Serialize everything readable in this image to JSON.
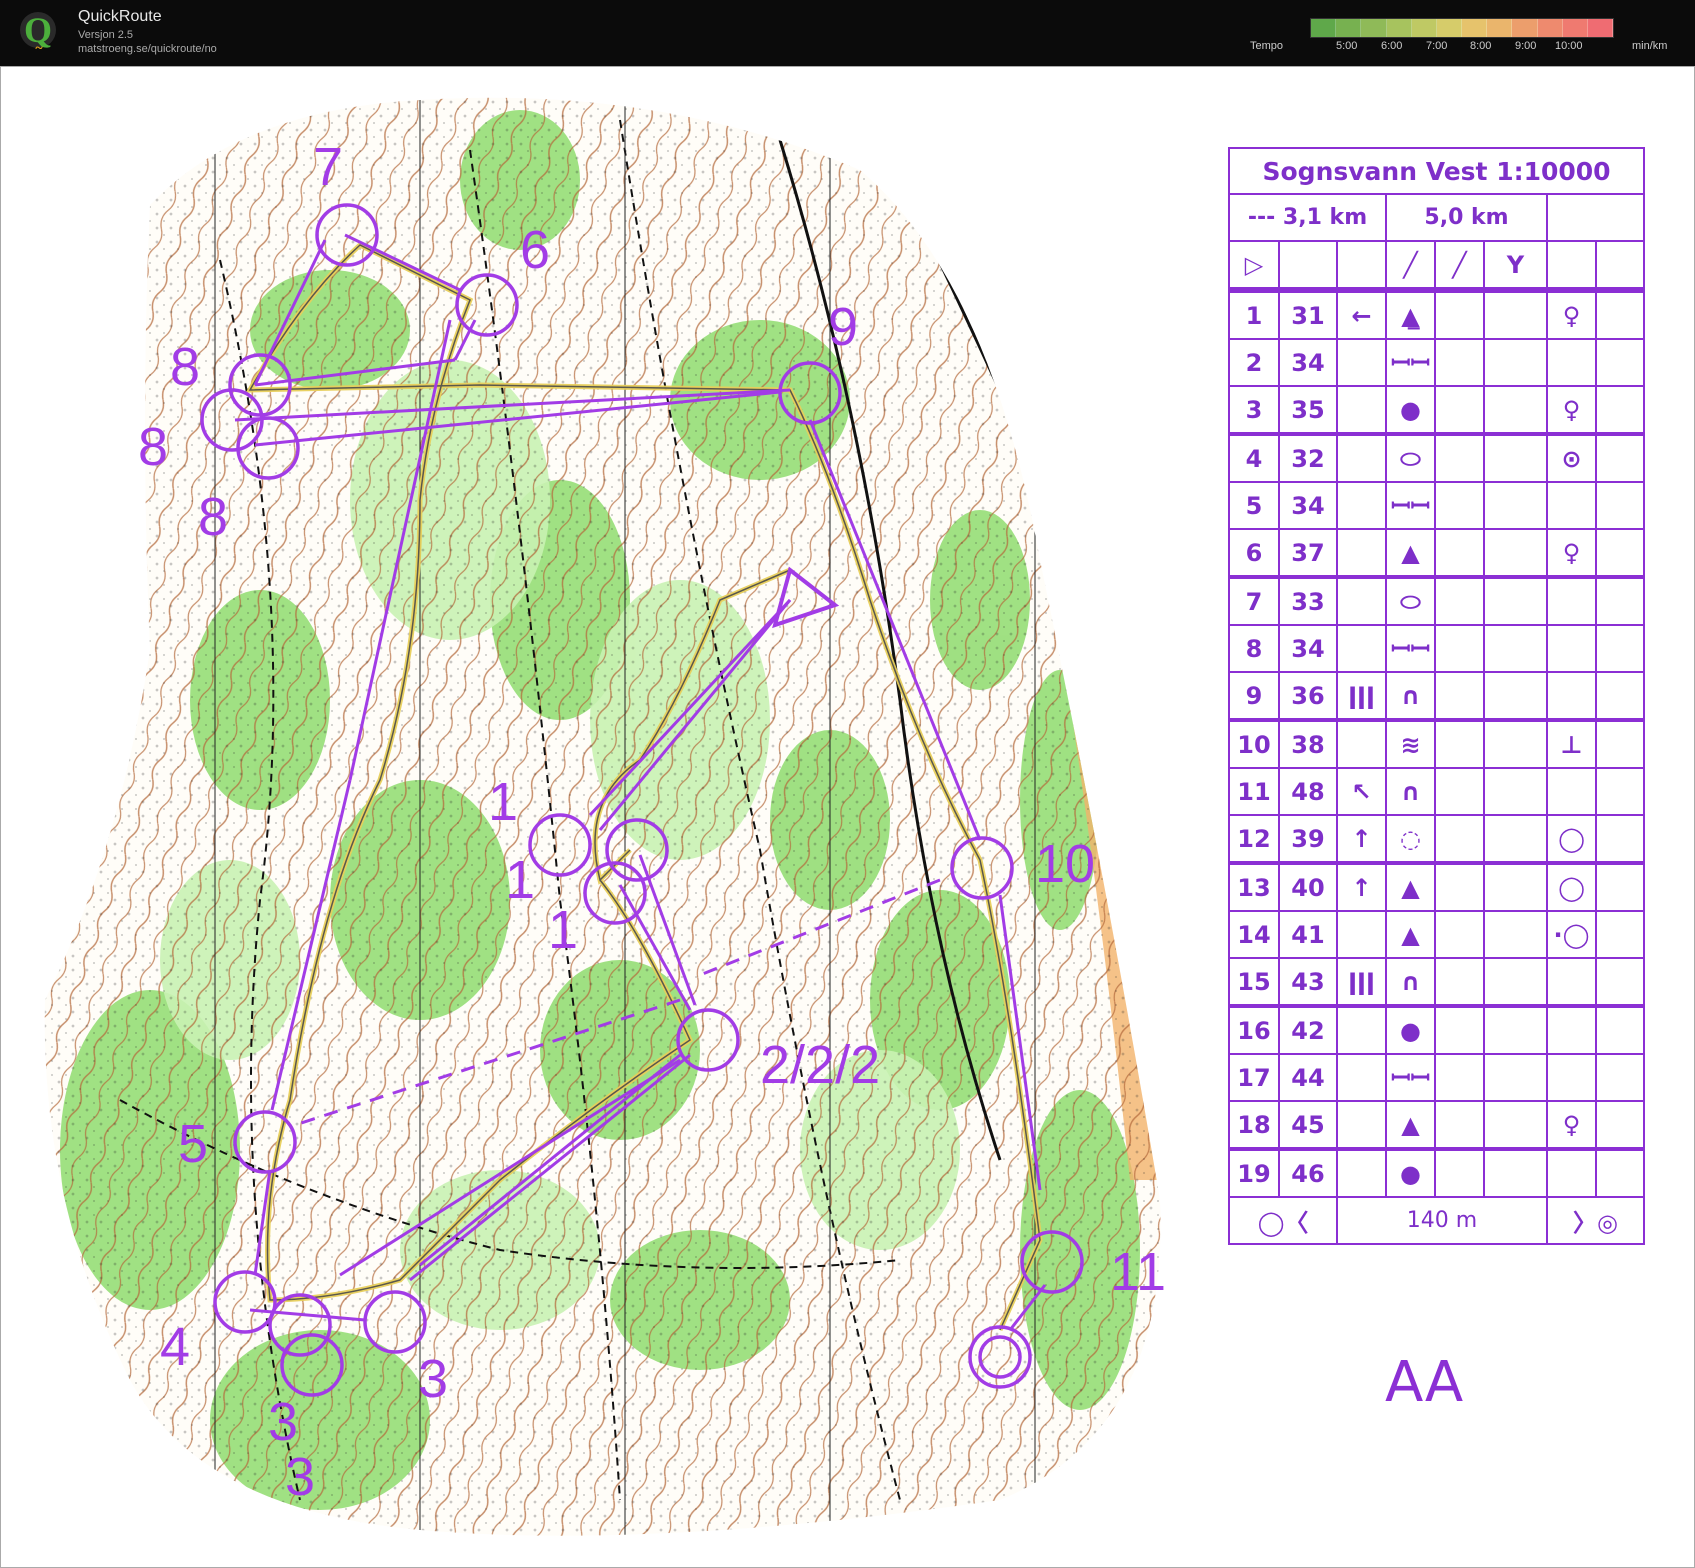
{
  "app": {
    "title": "QuickRoute",
    "version": "Versjon 2.5",
    "url": "matstroeng.se/quickroute/no"
  },
  "tempo": {
    "label": "Tempo",
    "ticks": [
      "5:00",
      "6:00",
      "7:00",
      "8:00",
      "9:00",
      "10:00"
    ],
    "unit": "min/km",
    "colors": [
      "#5fa84a",
      "#77b150",
      "#8fba58",
      "#a7c35e",
      "#bfc964",
      "#d6cc6a",
      "#e6c36c",
      "#eab56c",
      "#ec9e6c",
      "#ee8a6e",
      "#ef7a70",
      "#ef6c72"
    ]
  },
  "course": {
    "color": "#a23ce6",
    "control_labels": [
      {
        "text": "7"
      },
      {
        "text": "6"
      },
      {
        "text": "8"
      },
      {
        "text": "8"
      },
      {
        "text": "8"
      },
      {
        "text": "9"
      },
      {
        "text": "1"
      },
      {
        "text": "1"
      },
      {
        "text": "1"
      },
      {
        "text": "10"
      },
      {
        "text": "2/2/2"
      },
      {
        "text": "5"
      },
      {
        "text": "4"
      },
      {
        "text": "3"
      },
      {
        "text": "3"
      },
      {
        "text": "3"
      },
      {
        "text": "11"
      }
    ]
  },
  "description": {
    "title": "Sognsvann Vest 1:10000",
    "length_a": "--- 3,1 km",
    "length_b": "5,0 km",
    "rows": [
      {
        "n": "1",
        "code": "31",
        "dir": "←",
        "feature": "▲̲",
        "app": "♀"
      },
      {
        "n": "2",
        "code": "34",
        "dir": "",
        "feature": "ꟷꟷ",
        "app": ""
      },
      {
        "n": "3",
        "code": "35",
        "dir": "",
        "feature": "●",
        "app": "♀"
      },
      {
        "n": "4",
        "code": "32",
        "dir": "",
        "feature": "⬭",
        "app": "⊙"
      },
      {
        "n": "5",
        "code": "34",
        "dir": "",
        "feature": "ꟷꟷ",
        "app": ""
      },
      {
        "n": "6",
        "code": "37",
        "dir": "",
        "feature": "▲",
        "app": "♀"
      },
      {
        "n": "7",
        "code": "33",
        "dir": "",
        "feature": "⬭",
        "app": ""
      },
      {
        "n": "8",
        "code": "34",
        "dir": "",
        "feature": "ꟷꟷ",
        "app": ""
      },
      {
        "n": "9",
        "code": "36",
        "dir": "ǀǀǀ",
        "feature": "∩",
        "app": ""
      },
      {
        "n": "10",
        "code": "38",
        "dir": "",
        "feature": "≋",
        "app": "⊥"
      },
      {
        "n": "11",
        "code": "48",
        "dir": "↖",
        "feature": "∩",
        "app": ""
      },
      {
        "n": "12",
        "code": "39",
        "dir": "↑",
        "feature": "◌",
        "app": "◯"
      },
      {
        "n": "13",
        "code": "40",
        "dir": "↑",
        "feature": "▲",
        "app": "◯"
      },
      {
        "n": "14",
        "code": "41",
        "dir": "",
        "feature": "▲",
        "app": "·◯"
      },
      {
        "n": "15",
        "code": "43",
        "dir": "ǀǀǀ",
        "feature": "∩",
        "app": ""
      },
      {
        "n": "16",
        "code": "42",
        "dir": "",
        "feature": "●",
        "app": ""
      },
      {
        "n": "17",
        "code": "44",
        "dir": "",
        "feature": "ꟷꟷ",
        "app": ""
      },
      {
        "n": "18",
        "code": "45",
        "dir": "",
        "feature": "▲",
        "app": "♀"
      },
      {
        "n": "19",
        "code": "46",
        "dir": "",
        "feature": "●",
        "app": ""
      }
    ],
    "finish_distance": "140 m"
  },
  "class_label": "AA"
}
